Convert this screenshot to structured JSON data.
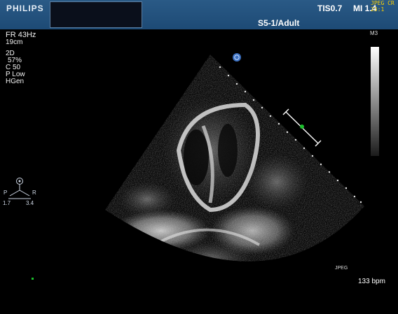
{
  "header": {
    "brand": "PHILIPS",
    "tis": "TIS0.7",
    "mi": "MI 1.4",
    "jpeg_cr": "JPEG CR 23:1",
    "probe": "S5-1/Adult"
  },
  "left_info": {
    "frame_rate": "FR 43Hz",
    "depth": "19cm",
    "mode": "2D",
    "gain": "57%",
    "compression": "C 50",
    "power": "P Low",
    "frequency": "HGen"
  },
  "orientation": {
    "left_label": "P",
    "right_label": "R",
    "left_value": "1.7",
    "right_value": "3.4"
  },
  "grayscale_label": "M3",
  "jpeg_tag": "JPEG",
  "heart_rate": "133 bpm",
  "colors": {
    "header_bg": "#1d4a75",
    "marker_green": "#1bbf2b",
    "jpeg_yellow": "#ffd200"
  }
}
